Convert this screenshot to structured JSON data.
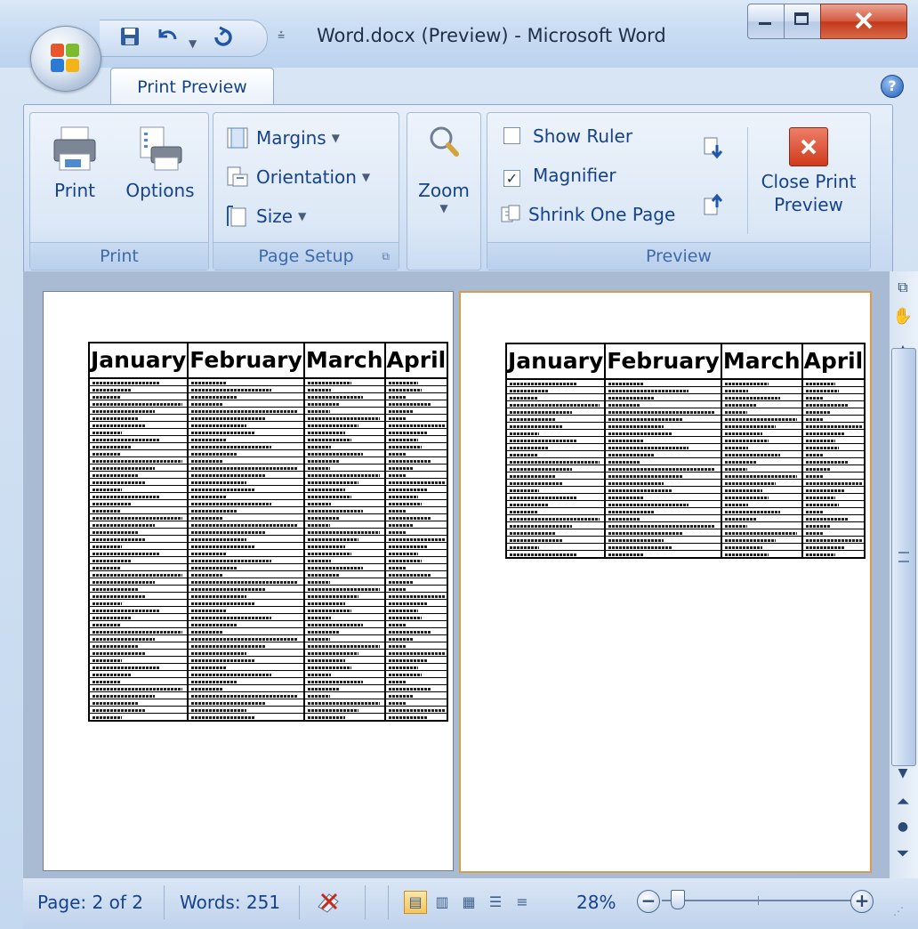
{
  "window": {
    "title": "Word.docx (Preview) - Microsoft Word",
    "buttons": {
      "minimize": "minimize-icon",
      "maximize": "maximize-icon",
      "close": "close-icon"
    }
  },
  "quick_access": {
    "save": "save-icon",
    "undo": "undo-icon",
    "redo": "redo-icon",
    "customize": "customize-icon"
  },
  "ribbon": {
    "tab": "Print Preview",
    "groups": {
      "print": {
        "label": "Print",
        "print_label": "Print",
        "options_label": "Options"
      },
      "page_setup": {
        "label": "Page Setup",
        "margins": "Margins",
        "orientation": "Orientation",
        "size": "Size"
      },
      "zoom": {
        "label": "Zoom"
      },
      "preview": {
        "label": "Preview",
        "show_ruler": "Show Ruler",
        "show_ruler_checked": false,
        "magnifier": "Magnifier",
        "magnifier_checked": true,
        "shrink_one_page": "Shrink One Page",
        "close_line1": "Close Print",
        "close_line2": "Preview"
      }
    }
  },
  "document": {
    "months": [
      "January",
      "February",
      "March",
      "April"
    ],
    "page1_rows": 48,
    "page2_rows": 25
  },
  "status": {
    "page": "Page: 2 of 2",
    "words": "Words: 251",
    "zoom": "28%",
    "zoom_level": 0.28
  },
  "colors": {
    "accent": "#15428b",
    "close_red": "#d5583d",
    "selected_page_border": "#d89b54"
  }
}
